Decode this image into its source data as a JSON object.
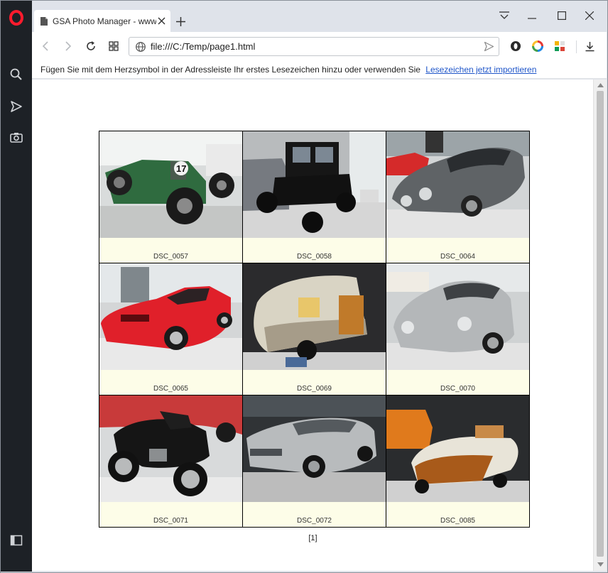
{
  "browser": {
    "tab_title": "GSA Photo Manager - www.gsa-online.de",
    "address": "file:///C:/Temp/page1.html",
    "bookmark_hint": "Fügen Sie mit dem Herzsymbol in der Adressleiste Ihr erstes Lesezeichen hinzu oder verwenden Sie",
    "bookmark_link": "Lesezeichen jetzt importieren"
  },
  "gallery": {
    "photos": [
      {
        "caption": "DSC_0057"
      },
      {
        "caption": "DSC_0058"
      },
      {
        "caption": "DSC_0064"
      },
      {
        "caption": "DSC_0065"
      },
      {
        "caption": "DSC_0069"
      },
      {
        "caption": "DSC_0070"
      },
      {
        "caption": "DSC_0071"
      },
      {
        "caption": "DSC_0072"
      },
      {
        "caption": "DSC_0085"
      }
    ],
    "pager": "[1]"
  },
  "icons": {
    "sidebar": [
      "opera-logo-icon",
      "search-icon",
      "send-icon",
      "camera-icon",
      "sidebar-toggle-icon"
    ],
    "toolbar": [
      "back-icon",
      "forward-icon",
      "reload-icon",
      "speed-dial-icon",
      "globe-icon",
      "send-icon",
      "vpn-icon",
      "extension-icon",
      "extension-icon",
      "download-icon"
    ]
  }
}
